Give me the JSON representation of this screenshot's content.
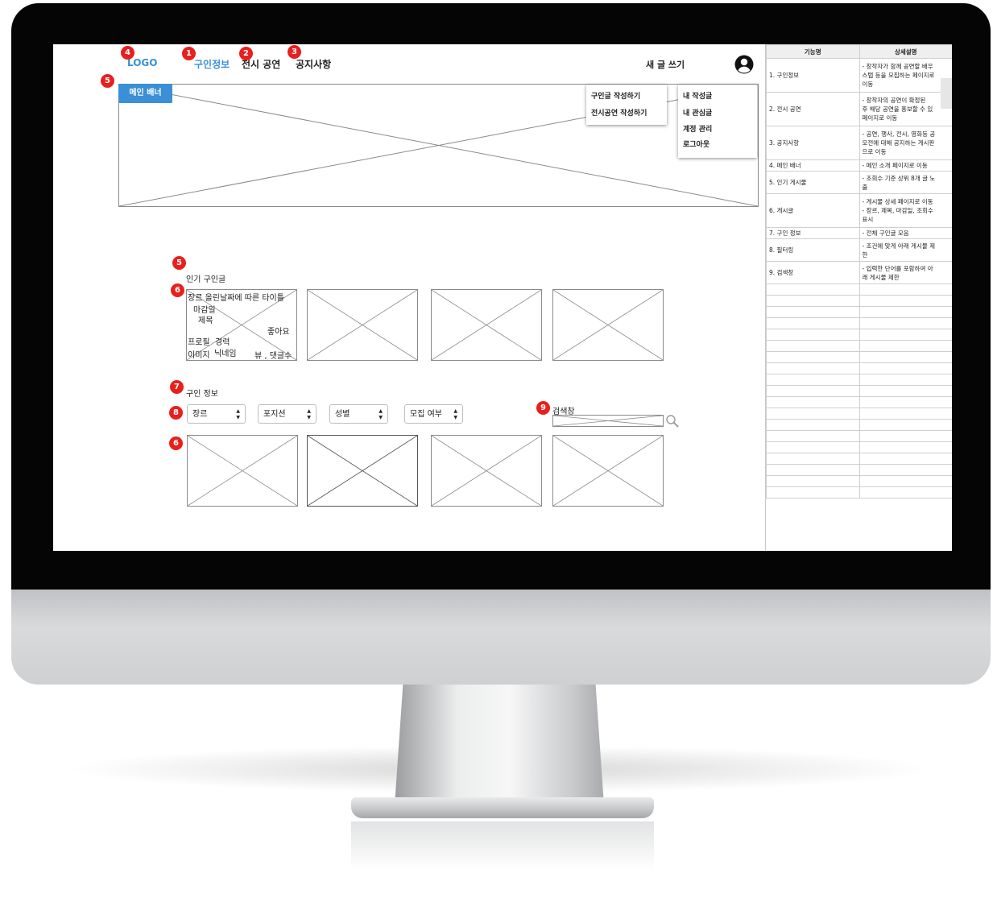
{
  "header": {
    "logo": "LOGO",
    "nav": [
      "구인정보",
      "전시 공연",
      "공지사항"
    ],
    "write_label": "새 글 쓰기"
  },
  "banner": {
    "label": "메인 배너"
  },
  "write_menu": [
    "구인글 작성하기",
    "전시공연 작성하기"
  ],
  "user_menu": [
    "내 작성글",
    "내 관심글",
    "계정 관리",
    "로그아웃"
  ],
  "popular": {
    "title": "인기 구인글",
    "card": {
      "line1": "장르  올린날짜에 따른 타이틀",
      "deadline": "마감일",
      "title": "제목",
      "likes": "좋아요",
      "profile": "프로필",
      "career": "경력",
      "image": "이미지",
      "nickname": "닉네임",
      "views": "뷰 , 댓글수"
    }
  },
  "jobs": {
    "title": "구인 정보",
    "filters": [
      "장르",
      "포지션",
      "성별",
      "모집 여부"
    ],
    "search_label": "검색창"
  },
  "badges": [
    "1",
    "2",
    "3",
    "4",
    "5",
    "5",
    "6",
    "7",
    "8",
    "6",
    "9"
  ],
  "spec_table": {
    "headers": [
      "기능명",
      "상세설명"
    ],
    "rows": [
      {
        "name": "1. 구인정보",
        "desc": [
          "- 창작자가 함께 공연할 배우",
          "스탭 등을 모집하는 페이지로",
          "이동"
        ]
      },
      {
        "name": "2. 전시 공연",
        "desc": [
          "- 창작자의 공연이 확정된",
          "후 해당 공연을 홍보할 수 있",
          "페이지로 이동"
        ]
      },
      {
        "name": "3. 공지사항",
        "desc": [
          "- 공연, 행사, 전시, 영화등 공",
          "모전에 대해 공지하는 게시판",
          "으로 이동"
        ]
      },
      {
        "name": "4. 메인 배너",
        "desc": [
          "- 메인 소개 페이지로 이동"
        ]
      },
      {
        "name": "5. 인기 게시물",
        "desc": [
          "- 조회수 기준 상위 8개 글 노",
          "출"
        ]
      },
      {
        "name": "6. 게시글",
        "desc": [
          "- 게시물 상세 페이지로 이동",
          "- 장르, 제목, 마감일, 조회수",
          "표시"
        ]
      },
      {
        "name": "7. 구인 정보",
        "desc": [
          "- 전체 구인글 모음"
        ]
      },
      {
        "name": "8. 필터링",
        "desc": [
          "- 조건에 맞게 아래 게시물 제",
          "한"
        ]
      },
      {
        "name": "9. 검색창",
        "desc": [
          "- 입력한 단어를 포함하여 아",
          "래 게시물 제한"
        ]
      }
    ]
  },
  "colors": {
    "accent": "#3a8fd6",
    "badge": "#e8201d",
    "bezel": "#050505"
  }
}
